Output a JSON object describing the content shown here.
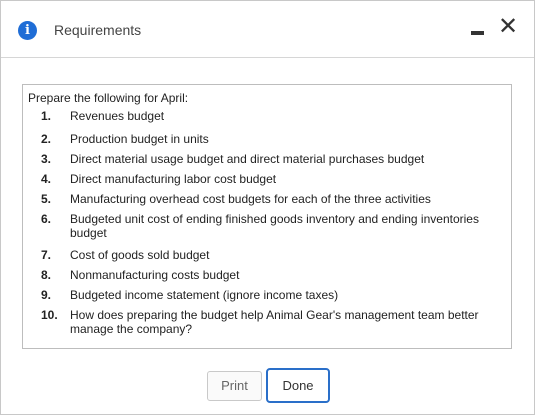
{
  "dialog": {
    "title": "Requirements",
    "close_glyph": "✕",
    "icon": "info-icon"
  },
  "content": {
    "intro": "Prepare the following for April:",
    "items": [
      {
        "num": "1.",
        "text": "Revenues budget"
      },
      {
        "num": "2.",
        "text": "Production budget in units"
      },
      {
        "num": "3.",
        "text": "Direct material usage budget and direct material purchases budget"
      },
      {
        "num": "4.",
        "text": "Direct manufacturing labor cost budget"
      },
      {
        "num": "5.",
        "text": "Manufacturing overhead cost budgets for each of the three activities"
      },
      {
        "num": "6.",
        "text": "Budgeted unit cost of ending finished goods inventory and ending inventories budget"
      },
      {
        "num": "7.",
        "text": "Cost of goods sold budget"
      },
      {
        "num": "8.",
        "text": "Nonmanufacturing costs budget"
      },
      {
        "num": "9.",
        "text": "Budgeted income statement (ignore income taxes)"
      },
      {
        "num": "10.",
        "text": "How does preparing the budget help Animal Gear's management team better manage the company?"
      }
    ]
  },
  "buttons": {
    "print": "Print",
    "done": "Done"
  },
  "colors": {
    "accent": "#1f6dd6",
    "done_border": "#2a6fc9"
  }
}
